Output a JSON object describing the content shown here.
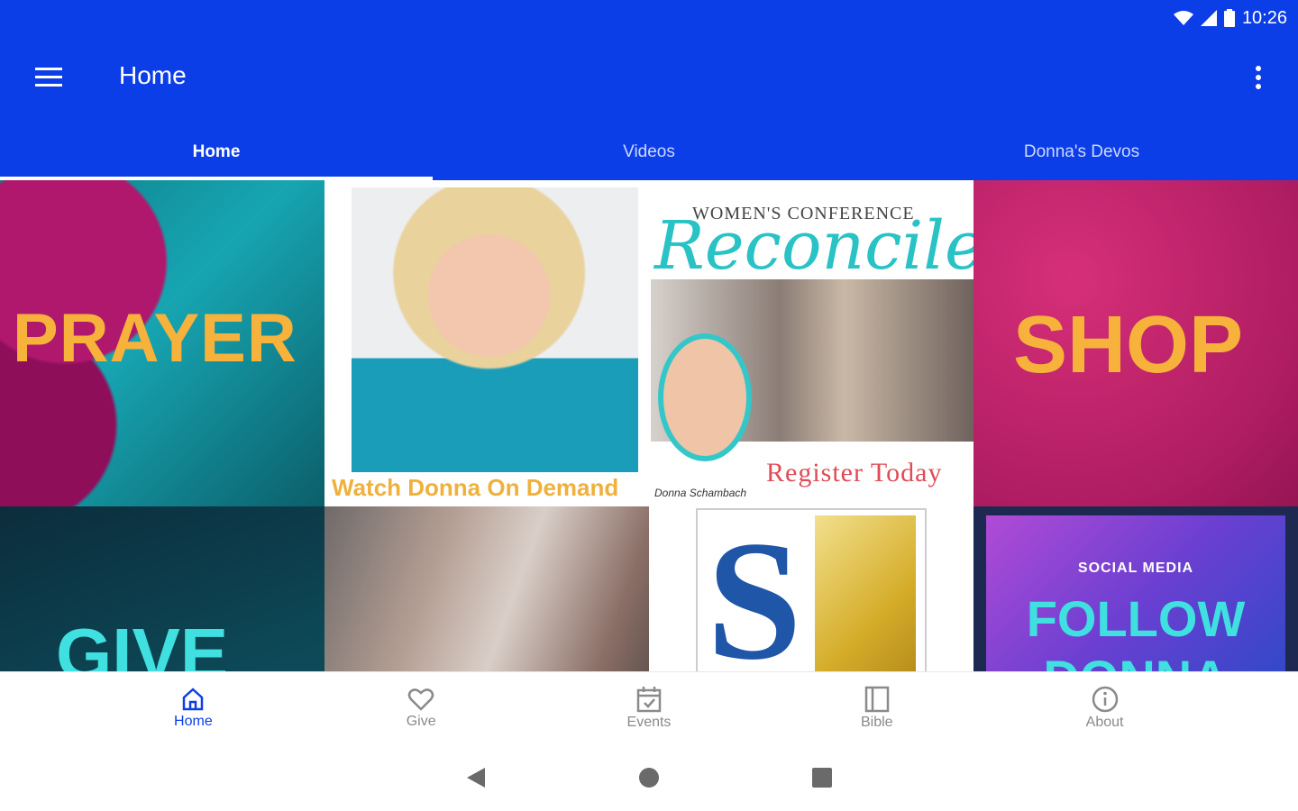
{
  "status_bar": {
    "time": "10:26"
  },
  "app_bar": {
    "title": "Home"
  },
  "tabs": [
    {
      "label": "Home",
      "active": true
    },
    {
      "label": "Videos",
      "active": false
    },
    {
      "label": "Donna's Devos",
      "active": false
    }
  ],
  "tiles": {
    "prayer": "PRAYER",
    "watch": "Watch Donna On Demand",
    "conference_eyebrow": "WOMEN'S CONFERENCE",
    "conference_script": "Reconcile",
    "conference_cta": "Register Today",
    "conference_signature": "Donna Schambach",
    "shop": "SHOP",
    "give": "GIVE",
    "social_small": "SOCIAL MEDIA",
    "social_big": "FOLLOW",
    "social_big2": "DONNA"
  },
  "bottom_nav": [
    {
      "label": "Home",
      "icon": "home-icon",
      "active": true
    },
    {
      "label": "Give",
      "icon": "heart-icon",
      "active": false
    },
    {
      "label": "Events",
      "icon": "calendar-icon",
      "active": false
    },
    {
      "label": "Bible",
      "icon": "book-icon",
      "active": false
    },
    {
      "label": "About",
      "icon": "info-icon",
      "active": false
    }
  ],
  "colors": {
    "primary": "#0c3ee8",
    "accent_gold": "#f7b23b",
    "accent_teal": "#3fe0df"
  }
}
